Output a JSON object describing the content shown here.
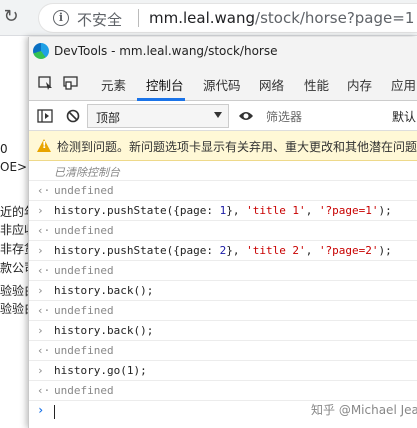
{
  "browser": {
    "insecure_label": "不安全",
    "url_host": "mm.leal.wang",
    "url_path": "/stock/horse?page=1"
  },
  "bg_page": {
    "lines": [
      "0",
      "OE>",
      "近的年",
      "非应收",
      "非存货",
      "款公司",
      "验验白",
      "验验白"
    ]
  },
  "devtools": {
    "title": "DevTools - mm.leal.wang/stock/horse",
    "tabs": [
      "元素",
      "控制台",
      "源代码",
      "网络",
      "性能",
      "内存",
      "应用"
    ],
    "active_tab": "控制台",
    "context_select": "顶部",
    "filter_placeholder": "筛选器",
    "default_levels": "默认",
    "warning": "检测到问题。新问题选项卡显示有关弃用、重大更改和其他潜在问题"
  },
  "console": {
    "cleared": "已清除控制台",
    "undefined": "undefined",
    "cmd_back": "history.back();",
    "cmd_go": "history.go(1);"
  },
  "watermark": "知乎 @Michael Jean"
}
